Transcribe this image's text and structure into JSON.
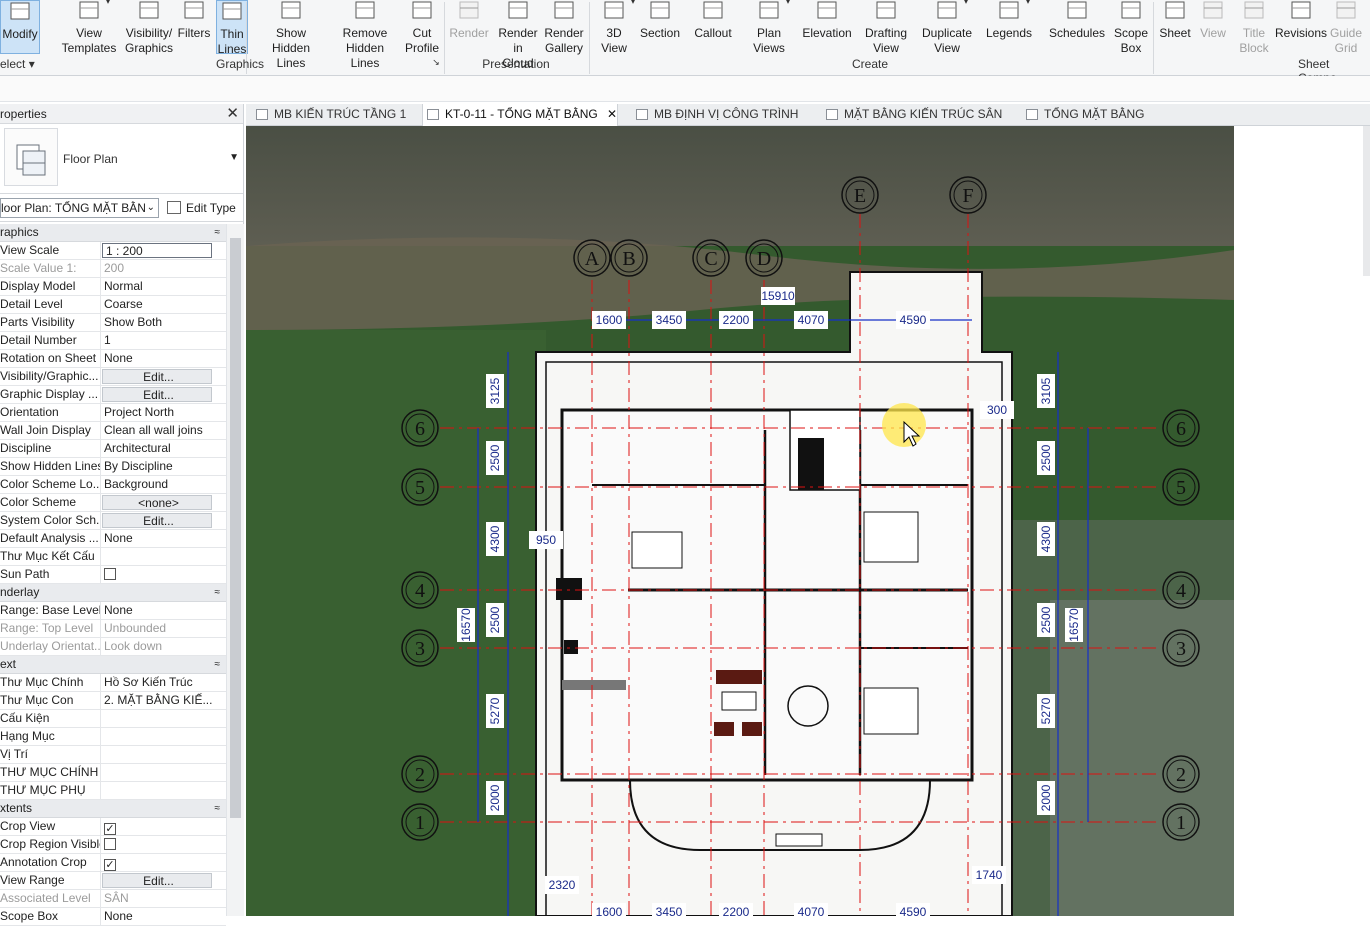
{
  "ribbon": {
    "buttons": [
      {
        "label": "Modify",
        "sub": ""
      },
      {
        "label": "View",
        "sub": "Templates"
      },
      {
        "label": "Visibility/",
        "sub": "Graphics"
      },
      {
        "label": "Filters",
        "sub": ""
      },
      {
        "label": "Thin",
        "sub": "Lines"
      },
      {
        "label": "Show",
        "sub": "Hidden Lines"
      },
      {
        "label": "Remove",
        "sub": "Hidden Lines"
      },
      {
        "label": "Cut",
        "sub": "Profile"
      },
      {
        "label": "Render",
        "sub": ""
      },
      {
        "label": "Render",
        "sub": "in Cloud"
      },
      {
        "label": "Render",
        "sub": "Gallery"
      },
      {
        "label": "3D",
        "sub": "View"
      },
      {
        "label": "Section",
        "sub": ""
      },
      {
        "label": "Callout",
        "sub": ""
      },
      {
        "label": "Plan",
        "sub": "Views"
      },
      {
        "label": "Elevation",
        "sub": ""
      },
      {
        "label": "Drafting",
        "sub": "View"
      },
      {
        "label": "Duplicate",
        "sub": "View"
      },
      {
        "label": "Legends",
        "sub": ""
      },
      {
        "label": "Schedules",
        "sub": ""
      },
      {
        "label": "Scope",
        "sub": "Box"
      },
      {
        "label": "Sheet",
        "sub": ""
      },
      {
        "label": "View",
        "sub": ""
      },
      {
        "label": "Title",
        "sub": "Block"
      },
      {
        "label": "Revisions",
        "sub": ""
      },
      {
        "label": "Guide",
        "sub": "Grid"
      }
    ],
    "groups": {
      "select": "elect",
      "graphics": "Graphics",
      "presentation": "Presentation",
      "create": "Create",
      "sheet": "Sheet Compo"
    }
  },
  "properties": {
    "title": "roperties",
    "type_name": "Floor Plan",
    "instance_selector": "loor Plan: TỔNG MẶT BẰN",
    "edit_type": "Edit Type",
    "groups": [
      {
        "name": "raphics",
        "rows": [
          {
            "name": "View Scale",
            "value": "1 : 200",
            "kind": "box"
          },
          {
            "name": "Scale Value 1:",
            "value": "200",
            "kind": "dim"
          },
          {
            "name": "Display Model",
            "value": "Normal"
          },
          {
            "name": "Detail Level",
            "value": "Coarse"
          },
          {
            "name": "Parts Visibility",
            "value": "Show Both"
          },
          {
            "name": "Detail Number",
            "value": "1"
          },
          {
            "name": "Rotation on Sheet",
            "value": "None"
          },
          {
            "name": "Visibility/Graphic...",
            "value": "Edit...",
            "kind": "btn"
          },
          {
            "name": "Graphic Display ...",
            "value": "Edit...",
            "kind": "btn"
          },
          {
            "name": "Orientation",
            "value": "Project North"
          },
          {
            "name": "Wall Join Display",
            "value": "Clean all wall joins"
          },
          {
            "name": "Discipline",
            "value": "Architectural"
          },
          {
            "name": "Show Hidden Lines",
            "value": "By Discipline"
          },
          {
            "name": "Color Scheme Lo...",
            "value": "Background"
          },
          {
            "name": "Color Scheme",
            "value": "<none>",
            "kind": "btn"
          },
          {
            "name": "System Color Sch...",
            "value": "Edit...",
            "kind": "btn"
          },
          {
            "name": "Default Analysis ...",
            "value": "None"
          },
          {
            "name": "Thư Mục Kết Cấu",
            "value": ""
          },
          {
            "name": "Sun Path",
            "value": "",
            "kind": "cb"
          }
        ]
      },
      {
        "name": "nderlay",
        "rows": [
          {
            "name": "Range: Base Level",
            "value": "None"
          },
          {
            "name": "Range: Top Level",
            "value": "Unbounded",
            "kind": "dim"
          },
          {
            "name": "Underlay Orientat...",
            "value": "Look down",
            "kind": "dim"
          }
        ]
      },
      {
        "name": "ext",
        "rows": [
          {
            "name": "Thư Mục Chính",
            "value": "Hồ Sơ Kiến Trúc"
          },
          {
            "name": "Thư Mục Con",
            "value": "2. MẶT BẰNG KIẾ..."
          },
          {
            "name": "Cấu Kiện",
            "value": ""
          },
          {
            "name": "Hạng Mục",
            "value": ""
          },
          {
            "name": "Vị Trí",
            "value": ""
          },
          {
            "name": "THƯ MỤC CHÍNH",
            "value": ""
          },
          {
            "name": "THƯ MỤC PHỤ",
            "value": ""
          }
        ]
      },
      {
        "name": "xtents",
        "rows": [
          {
            "name": "Crop View",
            "value": "✓",
            "kind": "cb"
          },
          {
            "name": "Crop Region Visible",
            "value": "",
            "kind": "cb"
          },
          {
            "name": "Annotation Crop",
            "value": "✓",
            "kind": "cb"
          },
          {
            "name": "View Range",
            "value": "Edit...",
            "kind": "btn"
          },
          {
            "name": "Associated Level",
            "value": "SÂN",
            "kind": "dim"
          },
          {
            "name": "Scope Box",
            "value": "None"
          }
        ]
      }
    ]
  },
  "tabs": [
    {
      "label": "MB KIẾN TRÚC TẦNG 1"
    },
    {
      "label": "KT-0-11 - TỔNG MẶT BẰNG",
      "active": true
    },
    {
      "label": "MB ĐỊNH VỊ CÔNG TRÌNH"
    },
    {
      "label": "MẶT BẰNG KIẾN TRÚC SÂN"
    },
    {
      "label": "TỔNG MẶT BẰNG"
    }
  ],
  "drawing": {
    "grid_cols": [
      "A",
      "B",
      "C",
      "D",
      "E",
      "F"
    ],
    "grid_rows": [
      "6",
      "5",
      "4",
      "3",
      "2",
      "1"
    ],
    "dims_top": [
      "1600",
      "3450",
      "2200",
      "4070",
      "4590"
    ],
    "dim_top_total": "15910",
    "dims_left": [
      "3125",
      "2500",
      "4300",
      "2500",
      "5270",
      "2000"
    ],
    "dims_right": [
      "3105",
      "2500",
      "4300",
      "2500",
      "5270",
      "2000"
    ],
    "dim_vertical_total": "16570",
    "dims_bottom": [
      "1600",
      "3450",
      "2200",
      "4070",
      "4590"
    ],
    "misc_dims": [
      "950",
      "2320",
      "1740",
      "300"
    ]
  }
}
